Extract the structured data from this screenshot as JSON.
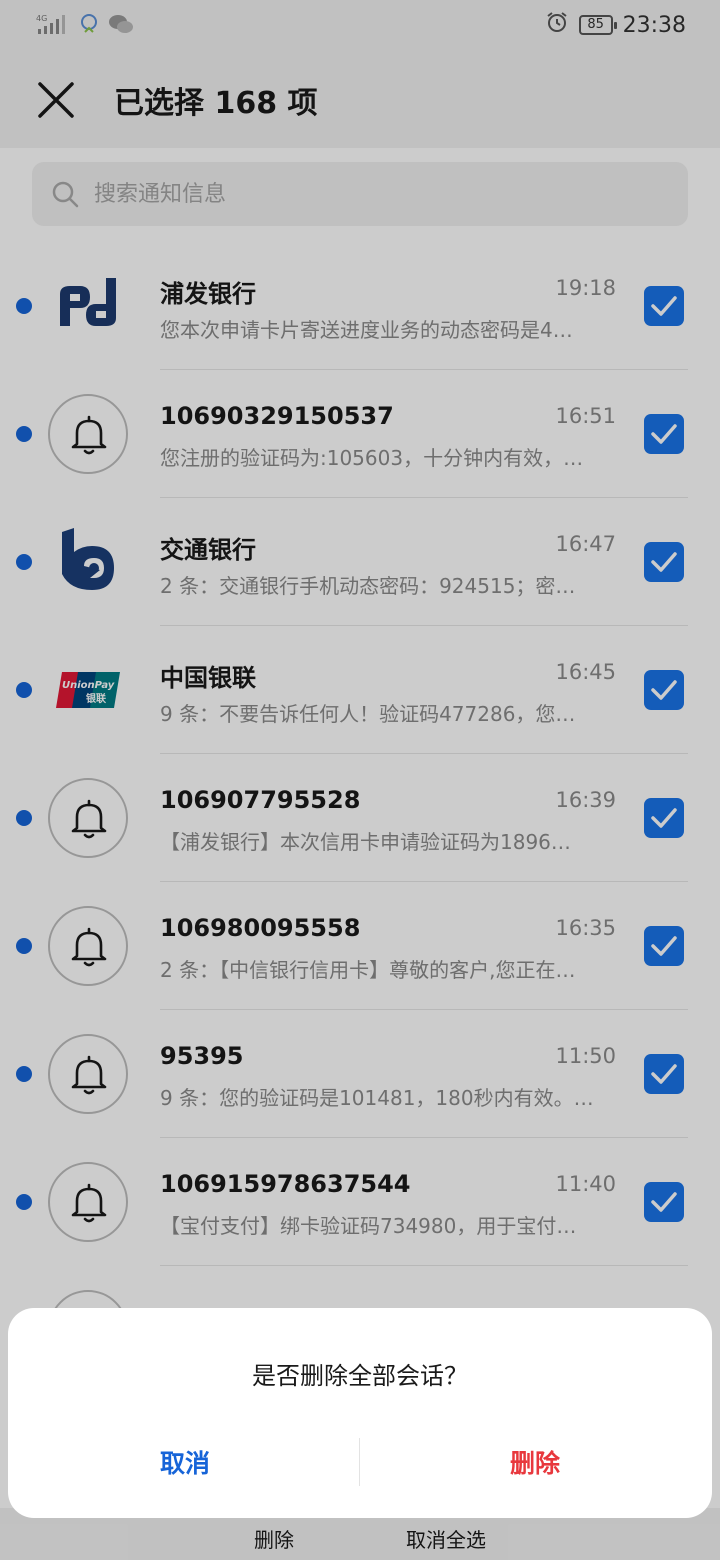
{
  "status_bar": {
    "network": "4G",
    "battery": "85",
    "time": "23:38",
    "icons": [
      "signal-icon",
      "assistant-icon",
      "wechat-icon",
      "alarm-icon",
      "battery-icon"
    ]
  },
  "header": {
    "title": "已选择 168 项",
    "close_icon": "close-icon"
  },
  "search": {
    "placeholder": "搜索通知信息",
    "icon": "search-icon"
  },
  "messages": [
    {
      "sender": "浦发银行",
      "time": "19:18",
      "preview": "您本次申请卡片寄送进度业务的动态密码是4…",
      "avatar": "spdb-logo",
      "checked": true,
      "unread": true
    },
    {
      "sender": "10690329150537",
      "time": "16:51",
      "preview": "您注册的验证码为:105603，十分钟内有效，…",
      "avatar": "bell-icon",
      "checked": true,
      "unread": true
    },
    {
      "sender": "交通银行",
      "time": "16:47",
      "preview": "2 条：交通银行手机动态密码：924515；密…",
      "avatar": "bocom-logo",
      "checked": true,
      "unread": true
    },
    {
      "sender": "中国银联",
      "time": "16:45",
      "preview": "9 条：不要告诉任何人！验证码477286，您…",
      "avatar": "unionpay-logo",
      "checked": true,
      "unread": true
    },
    {
      "sender": "106907795528",
      "time": "16:39",
      "preview": "【浦发银行】本次信用卡申请验证码为1896…",
      "avatar": "bell-icon",
      "checked": true,
      "unread": true
    },
    {
      "sender": "106980095558",
      "time": "16:35",
      "preview": "2 条：【中信银行信用卡】尊敬的客户,您正在…",
      "avatar": "bell-icon",
      "checked": true,
      "unread": true
    },
    {
      "sender": "95395",
      "time": "11:50",
      "preview": "9 条：您的验证码是101481，180秒内有效。…",
      "avatar": "bell-icon",
      "checked": true,
      "unread": true
    },
    {
      "sender": "106915978637544",
      "time": "11:40",
      "preview": "【宝付支付】绑卡验证码734980，用于宝付…",
      "avatar": "bell-icon",
      "checked": true,
      "unread": true
    }
  ],
  "unionpay_logo_text": {
    "top": "UnionPay",
    "bottom": "银联"
  },
  "dialog": {
    "message": "是否删除全部会话？",
    "cancel_label": "取消",
    "delete_label": "删除"
  },
  "bottom_bar": {
    "delete_label": "删除",
    "deselect_all_label": "取消全选"
  },
  "colors": {
    "accent": "#1a73e8",
    "unread_dot": "#1664d8",
    "delete_red": "#e8383d",
    "spdb_navy": "#1d3a6e",
    "bocom_navy": "#1c3f7a"
  }
}
